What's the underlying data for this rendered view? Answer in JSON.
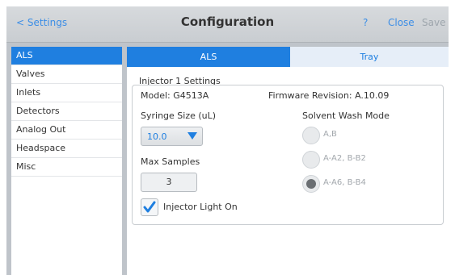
{
  "header": {
    "back_label": "< Settings",
    "title": "Configuration",
    "help_label": "?",
    "close_label": "Close",
    "save_label": "Save"
  },
  "sidebar": {
    "items": [
      {
        "label": "ALS",
        "active": true
      },
      {
        "label": "Valves"
      },
      {
        "label": "Inlets"
      },
      {
        "label": "Detectors"
      },
      {
        "label": "Analog Out"
      },
      {
        "label": "Headspace"
      },
      {
        "label": "Misc"
      }
    ]
  },
  "tabs": [
    {
      "label": "ALS",
      "active": true
    },
    {
      "label": "Tray"
    }
  ],
  "injector": {
    "section_title": "Injector 1 Settings",
    "model_text": "Model: G4513A",
    "firmware_text": "Firmware Revision: A.10.09",
    "syringe_label": "Syringe Size (uL)",
    "syringe_value": "10.0",
    "max_samples_label": "Max Samples",
    "max_samples_value": "3",
    "light_label": "Injector Light On",
    "light_checked": true,
    "wash_label": "Solvent Wash Mode",
    "wash_options": [
      {
        "label": "A,B",
        "selected": false
      },
      {
        "label": "A-A2, B-B2",
        "selected": false
      },
      {
        "label": "A-A6, B-B4",
        "selected": true
      }
    ]
  },
  "colors": {
    "accent": "#1f7fe0",
    "link": "#3c8ee6",
    "disabled_text": "#9ea6ad",
    "frame_bg": "#bfc4ca"
  }
}
